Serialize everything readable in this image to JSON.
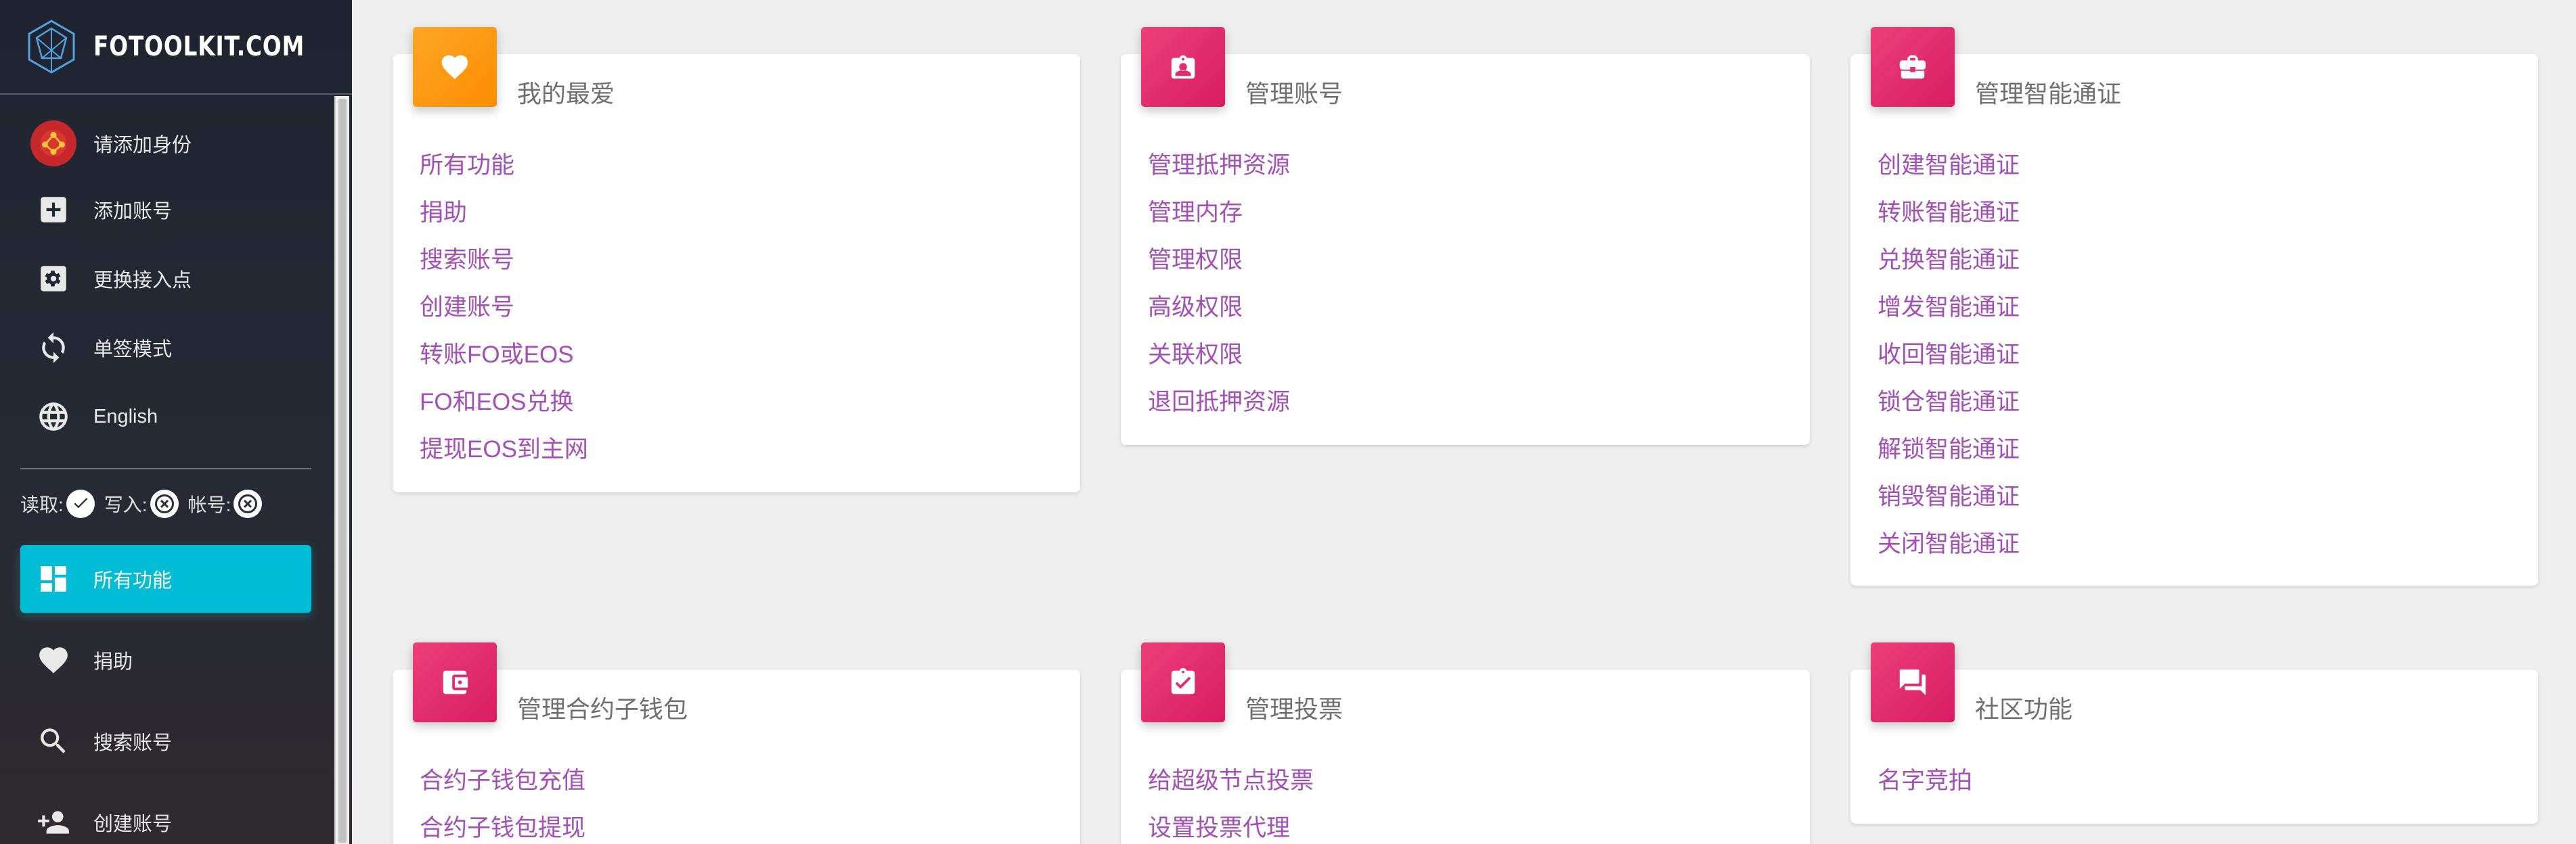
{
  "brand": {
    "name": "FOTOOLKIT.COM"
  },
  "sidebar": {
    "top_items": [
      {
        "label": "请添加身份",
        "icon": "identity-avatar-icon"
      },
      {
        "label": "添加账号",
        "icon": "add-box-icon"
      },
      {
        "label": "更换接入点",
        "icon": "settings-icon"
      },
      {
        "label": "单签模式",
        "icon": "sync-icon"
      },
      {
        "label": "English",
        "icon": "globe-icon"
      }
    ],
    "permissions": {
      "read_label": "读取:",
      "write_label": "写入:",
      "account_label": "帐号:",
      "read_state": "check-circle-icon",
      "write_state": "cancel-circle-icon",
      "account_state": "cancel-circle-icon"
    },
    "nav_items": [
      {
        "label": "所有功能",
        "icon": "dashboard-icon",
        "active": true
      },
      {
        "label": "捐助",
        "icon": "heart-icon"
      },
      {
        "label": "搜索账号",
        "icon": "search-icon"
      },
      {
        "label": "创建账号",
        "icon": "person-add-icon"
      }
    ],
    "accent_color": "#00bcd4"
  },
  "cards": [
    {
      "title": "我的最爱",
      "icon": "heart-icon",
      "color": "#fb8c00",
      "links": [
        "所有功能",
        "捐助",
        "搜索账号",
        "创建账号",
        "转账FO或EOS",
        "FO和EOS兑换",
        "提现EOS到主网"
      ]
    },
    {
      "title": "管理账号",
      "icon": "account-badge-icon",
      "color": "#e91e63",
      "links": [
        "管理抵押资源",
        "管理内存",
        "管理权限",
        "高级权限",
        "关联权限",
        "退回抵押资源"
      ]
    },
    {
      "title": "管理智能通证",
      "icon": "briefcase-icon",
      "color": "#e91e63",
      "links": [
        "创建智能通证",
        "转账智能通证",
        "兑换智能通证",
        "增发智能通证",
        "收回智能通证",
        "锁仓智能通证",
        "解锁智能通证",
        "销毁智能通证",
        "关闭智能通证"
      ]
    },
    {
      "title": "管理合约子钱包",
      "icon": "wallet-icon",
      "color": "#e91e63",
      "links": [
        "合约子钱包充值",
        "合约子钱包提现"
      ]
    },
    {
      "title": "管理投票",
      "icon": "clipboard-check-icon",
      "color": "#e91e63",
      "links": [
        "给超级节点投票",
        "设置投票代理"
      ]
    },
    {
      "title": "社区功能",
      "icon": "forum-icon",
      "color": "#e91e63",
      "links": [
        "名字竞拍"
      ]
    }
  ]
}
